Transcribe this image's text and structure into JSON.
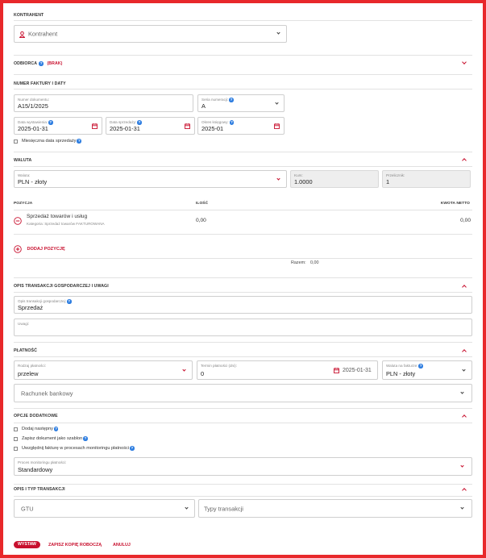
{
  "kontrahent": {
    "section": "KONTRAHENT",
    "placeholder": "Kontrahent"
  },
  "odbiorca": {
    "section": "ODBIORCA",
    "badge": "(BRAK)"
  },
  "numer": {
    "section": "NUMER FAKTURY I DATY",
    "doc_label": "Numer dokumentu:",
    "doc_value": "A15/1/2025",
    "seria_label": "Seria numeracji:",
    "seria_value": "A",
    "date_issue_label": "Data wystawienia:",
    "date_issue_value": "2025-01-31",
    "date_sale_label": "Data sprzedaży:",
    "date_sale_value": "2025-01-31",
    "period_label": "Okres księgowy:",
    "period_value": "2025-01",
    "monthly_label": "Miesięczna data sprzedaży"
  },
  "waluta": {
    "section": "WALUTA",
    "currency_label": "Waluta:",
    "currency_value": "PLN - złoty",
    "rate_label": "Kurs:",
    "rate_value": "1.0000",
    "converter_label": "Przelicznik:",
    "converter_value": "1"
  },
  "pozycje": {
    "col_pozycja": "POZYCJA",
    "col_ilosc": "ILOŚĆ",
    "col_netto": "KWOTA NETTO",
    "item_name": "Sprzedaż towarów i usług",
    "item_sub": "Kategoria: Sprzedaż towarów FAKTUROWANA",
    "item_qty": "0,00",
    "item_netto": "0,00",
    "add_label": "DODAJ POZYCJĘ",
    "total_label": "Razem:",
    "total_value": "0,00"
  },
  "opis": {
    "section": "OPIS TRANSAKCJI GOSPODARCZEJ I UWAGI",
    "desc_label": "Opis transakcji gospodarczej:",
    "desc_value": "Sprzedaż",
    "notes_label": "Uwagi:"
  },
  "platnosc": {
    "section": "PŁATNOŚĆ",
    "method_label": "Rodzaj płatności:",
    "method_value": "przelew",
    "term_label": "Termin płatności (dni):",
    "term_value": "0",
    "due_value": "2025-01-31",
    "inv_currency_label": "Waluta na fakturze:",
    "inv_currency_value": "PLN - złoty",
    "bank_placeholder": "Rachunek bankowy"
  },
  "opcje": {
    "section": "OPCJE DODATKOWE",
    "opt1": "Dodaj następny",
    "opt2": "Zapisz dokument jako szablon",
    "opt3": "Uwzględnij fakturę w procesach monitoringu płatności",
    "process_label": "Proces monitoringu płatności:",
    "process_value": "Standardowy"
  },
  "typ": {
    "section": "OPIS I TYP TRANSAKCJI",
    "gtu_placeholder": "GTU",
    "types_placeholder": "Typy transakcji"
  },
  "actions": {
    "send": "WYSTAW",
    "draft": "ZAPISZ KOPIĘ ROBOCZĄ",
    "cancel": "ANULUJ"
  },
  "colors": {
    "accent": "#c8102e",
    "frame": "#e8282b",
    "help": "#2d7de0"
  }
}
